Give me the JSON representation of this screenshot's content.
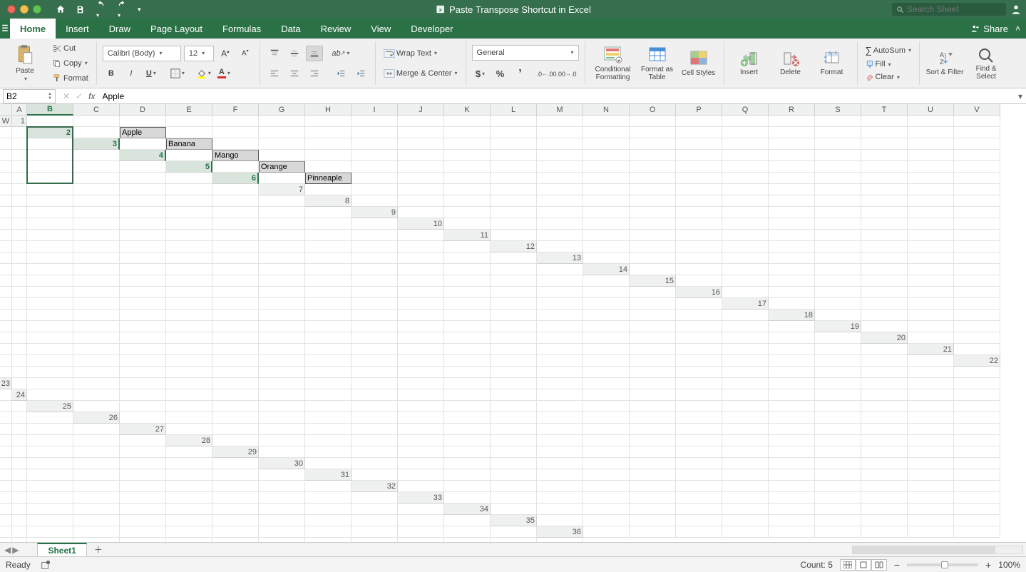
{
  "title": "Paste Transpose Shortcut in Excel",
  "search_placeholder": "Search Sheet",
  "tabs": [
    "Home",
    "Insert",
    "Draw",
    "Page Layout",
    "Formulas",
    "Data",
    "Review",
    "View",
    "Developer"
  ],
  "active_tab": "Home",
  "share_label": "Share",
  "ribbon": {
    "paste": "Paste",
    "cut": "Cut",
    "copy": "Copy",
    "format_painter": "Format",
    "font_name": "Calibri (Body)",
    "font_size": "12",
    "wrap_text": "Wrap Text",
    "merge_center": "Merge & Center",
    "number_format": "General",
    "conditional_formatting": "Conditional Formatting",
    "format_as_table": "Format as Table",
    "cell_styles": "Cell Styles",
    "insert": "Insert",
    "delete": "Delete",
    "format": "Format",
    "autosum": "AutoSum",
    "fill": "Fill",
    "clear": "Clear",
    "sort_filter": "Sort & Filter",
    "find_select": "Find & Select"
  },
  "namebox": "B2",
  "formula": "Apple",
  "columns": [
    "A",
    "B",
    "C",
    "D",
    "E",
    "F",
    "G",
    "H",
    "I",
    "J",
    "K",
    "L",
    "M",
    "N",
    "O",
    "P",
    "Q",
    "R",
    "S",
    "T",
    "U",
    "V",
    "W"
  ],
  "row_count": 36,
  "data": {
    "B2": "Apple",
    "B3": "Banana",
    "B4": "Mango",
    "B5": "Orange",
    "B6": "Pinneaple"
  },
  "selected_range": {
    "col": "B",
    "row_start": 2,
    "row_end": 6
  },
  "sheet_name": "Sheet1",
  "status": {
    "ready": "Ready",
    "count_label": "Count:",
    "count": "5",
    "zoom": "100%"
  }
}
